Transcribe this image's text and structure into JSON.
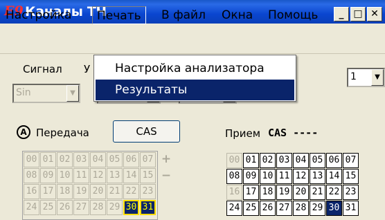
{
  "window": {
    "logo": "E9",
    "title": "Каналы ТЧ",
    "minimize": "_",
    "maximize": "□",
    "close": "✕"
  },
  "menu": {
    "items": [
      "Настройка",
      "Печать",
      "В файл",
      "Окна",
      "Помощь"
    ]
  },
  "dropdown": {
    "items": [
      "Настройка анализатора",
      "Результаты"
    ]
  },
  "toolbar": {
    "signal_label": "Сигнал",
    "level_label": "У",
    "signal_combo": "Sin",
    "right_combo": "1"
  },
  "transmit": {
    "label": "Передача",
    "icon_letter": "A",
    "cas_button": "CAS",
    "cells": [
      "00",
      "01",
      "02",
      "03",
      "04",
      "05",
      "06",
      "07",
      "08",
      "09",
      "10",
      "11",
      "12",
      "13",
      "14",
      "15",
      "16",
      "17",
      "18",
      "19",
      "20",
      "21",
      "22",
      "23",
      "24",
      "25",
      "26",
      "27",
      "28",
      "29",
      "30",
      "31"
    ],
    "plus": "+",
    "minus": "−"
  },
  "receive": {
    "label": "Прием",
    "cas_title": "CAS ----",
    "cells": [
      "00",
      "01",
      "02",
      "03",
      "04",
      "05",
      "06",
      "07",
      "08",
      "09",
      "10",
      "11",
      "12",
      "13",
      "14",
      "15",
      "16",
      "17",
      "18",
      "19",
      "20",
      "21",
      "22",
      "23",
      "24",
      "25",
      "26",
      "27",
      "28",
      "29",
      "30",
      "31"
    ]
  },
  "colors": {
    "titlebar": "#0a46d0",
    "selection": "#0a246a",
    "highlight": "#ffff00"
  }
}
